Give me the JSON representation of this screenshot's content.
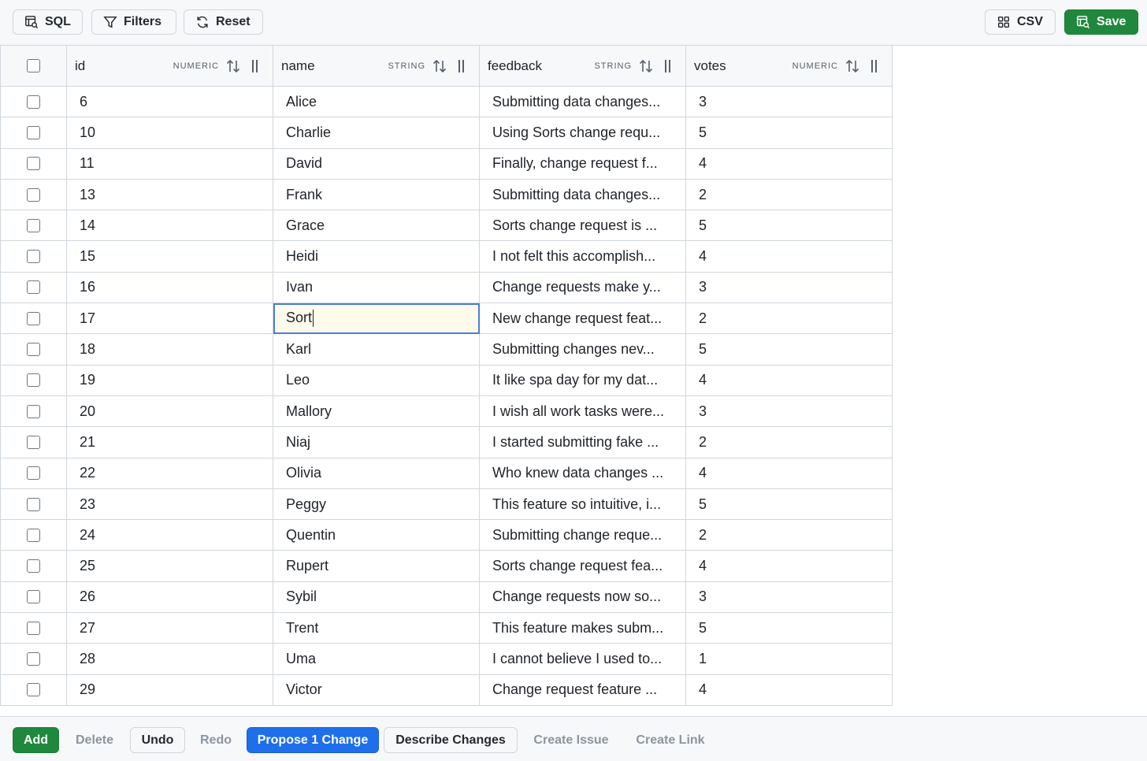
{
  "toolbar": {
    "sql_label": "SQL",
    "filters_label": "Filters",
    "reset_label": "Reset",
    "csv_label": "CSV",
    "save_label": "Save"
  },
  "columns": [
    {
      "name": "id",
      "type": "NUMERIC"
    },
    {
      "name": "name",
      "type": "STRING"
    },
    {
      "name": "feedback",
      "type": "STRING"
    },
    {
      "name": "votes",
      "type": "NUMERIC"
    }
  ],
  "rows": [
    {
      "id": "6",
      "name": "Alice",
      "feedback": "Submitting data changes...",
      "votes": "3"
    },
    {
      "id": "10",
      "name": "Charlie",
      "feedback": "Using Sorts change requ...",
      "votes": "5"
    },
    {
      "id": "11",
      "name": "David",
      "feedback": "Finally, change request f...",
      "votes": "4"
    },
    {
      "id": "13",
      "name": "Frank",
      "feedback": "Submitting data changes...",
      "votes": "2"
    },
    {
      "id": "14",
      "name": "Grace",
      "feedback": "Sorts change request is ...",
      "votes": "5"
    },
    {
      "id": "15",
      "name": "Heidi",
      "feedback": "I not felt this accomplish...",
      "votes": "4"
    },
    {
      "id": "16",
      "name": "Ivan",
      "feedback": "Change requests make y...",
      "votes": "3"
    },
    {
      "id": "17",
      "name": "Sort",
      "feedback": "New change request feat...",
      "votes": "2",
      "editing": true
    },
    {
      "id": "18",
      "name": "Karl",
      "feedback": "Submitting changes nev...",
      "votes": "5"
    },
    {
      "id": "19",
      "name": "Leo",
      "feedback": "It like spa day for my dat...",
      "votes": "4"
    },
    {
      "id": "20",
      "name": "Mallory",
      "feedback": "I wish all work tasks were...",
      "votes": "3"
    },
    {
      "id": "21",
      "name": "Niaj",
      "feedback": "I started submitting fake ...",
      "votes": "2"
    },
    {
      "id": "22",
      "name": "Olivia",
      "feedback": "Who knew data changes ...",
      "votes": "4"
    },
    {
      "id": "23",
      "name": "Peggy",
      "feedback": "This feature so intuitive, i...",
      "votes": "5"
    },
    {
      "id": "24",
      "name": "Quentin",
      "feedback": "Submitting change reque...",
      "votes": "2"
    },
    {
      "id": "25",
      "name": "Rupert",
      "feedback": "Sorts change request fea...",
      "votes": "4"
    },
    {
      "id": "26",
      "name": "Sybil",
      "feedback": "Change requests now so...",
      "votes": "3"
    },
    {
      "id": "27",
      "name": "Trent",
      "feedback": "This feature makes subm...",
      "votes": "5"
    },
    {
      "id": "28",
      "name": "Uma",
      "feedback": "I cannot believe I used to...",
      "votes": "1"
    },
    {
      "id": "29",
      "name": "Victor",
      "feedback": "Change request feature ...",
      "votes": "4"
    }
  ],
  "bottombar": {
    "add_label": "Add",
    "delete_label": "Delete",
    "undo_label": "Undo",
    "redo_label": "Redo",
    "propose_label": "Propose 1 Change",
    "describe_label": "Describe Changes",
    "create_issue_label": "Create Issue",
    "create_link_label": "Create Link"
  },
  "colors": {
    "save_green": "#1f883d",
    "propose_blue": "#1f6feb",
    "edit_highlight": "#fffbeb",
    "edit_border": "#4a7fd6"
  }
}
